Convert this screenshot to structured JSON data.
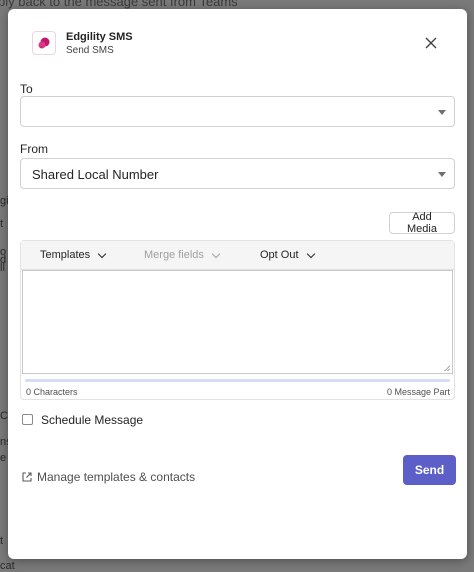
{
  "background": {
    "top_text": "ply back to the message sent from Teams",
    "strip_items": [
      "gi",
      "t",
      "o",
      "d",
      "ll",
      "Co",
      "ns",
      "e",
      "t",
      "cat"
    ]
  },
  "dialog": {
    "app_name": "Edgility SMS",
    "app_subtitle": "Send SMS",
    "close_icon": "close-icon",
    "to_label": "To",
    "to_value": "",
    "from_label": "From",
    "from_value": "Shared Local Number",
    "add_media_label": "Add Media",
    "toolbar": {
      "templates": "Templates",
      "merge_fields": "Merge fields",
      "opt_out": "Opt Out"
    },
    "message_text": "",
    "characters_label": "0 Characters",
    "message_part_label": "0 Message Part",
    "schedule_label": "Schedule Message",
    "manage_link": "Manage templates & contacts",
    "send_label": "Send"
  },
  "colors": {
    "accent": "#5b5fc7",
    "brand": "#c4166b"
  }
}
